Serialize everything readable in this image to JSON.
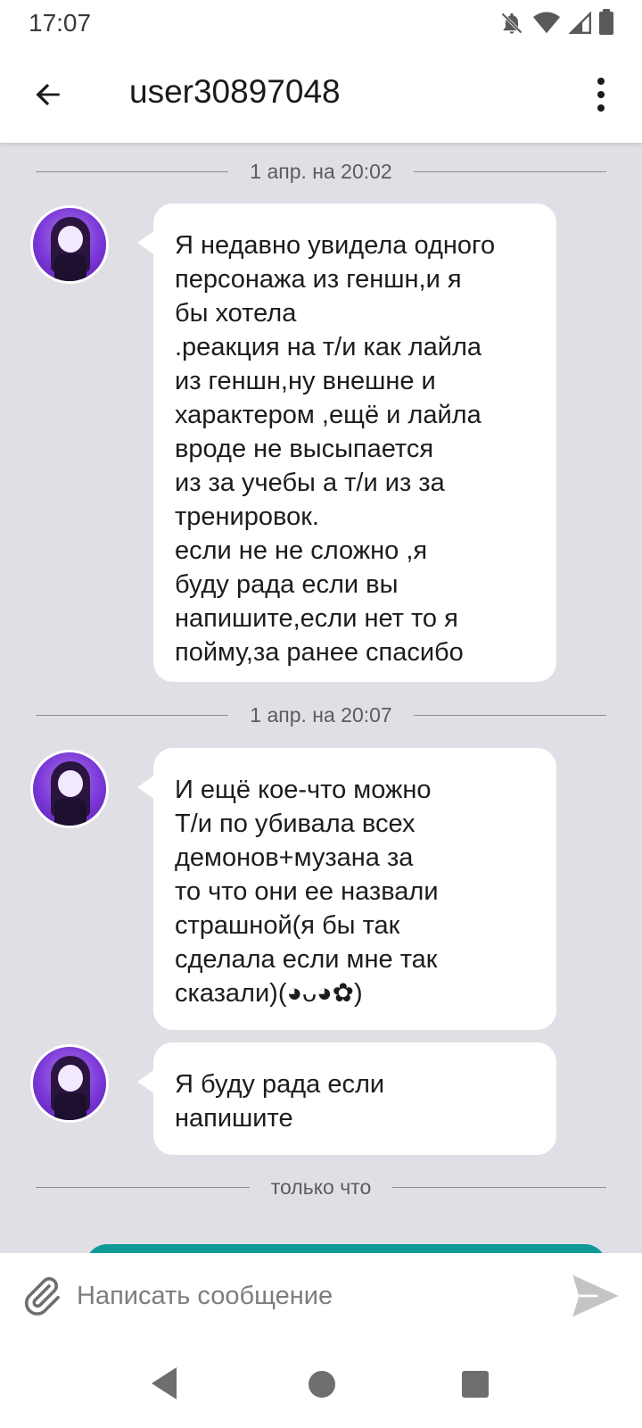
{
  "status_bar": {
    "time": "17:07",
    "icons": [
      "bell-off-icon",
      "wifi-icon",
      "signal-icon",
      "battery-icon"
    ]
  },
  "header": {
    "title": "user30897048",
    "back_icon": "arrow-left-icon",
    "menu_icon": "more-vertical-icon"
  },
  "chat": {
    "separators": [
      "1 апр. на 20:02",
      "1 апр. на 20:07",
      "только что"
    ],
    "messages": [
      {
        "text": "Я недавно увидела одного\nперсонажа из геншн,и я\nбы хотела\n.реакция на т/и как лайла\nиз геншн,ну внешне и\nхарактером ,ещё и лайла\nвроде не высыпается\nиз за учебы а т/и из за\nтренировок.\n если не не сложно ,я\nбуду рада если вы\nнапишите,если нет то я\nпойму,за ранее спасибо"
      },
      {
        "text": "И ещё кое-что можно\nТ/и по убивала всех\nдемонов+музана за\nто что они ее назвали\nстрашной(я бы так\nсделала если мне так\nсказали)(◕ᴗ◕✿)"
      },
      {
        "text": "Я буду рада если\nнапишите"
      }
    ]
  },
  "composer": {
    "placeholder": "Написать сообщение",
    "attach_icon": "paperclip-icon",
    "send_icon": "send-icon"
  },
  "colors": {
    "chat_background": "#e0dfe5",
    "sent_bubble": "#0e9b98",
    "avatar_accent": "#7a38d8"
  }
}
